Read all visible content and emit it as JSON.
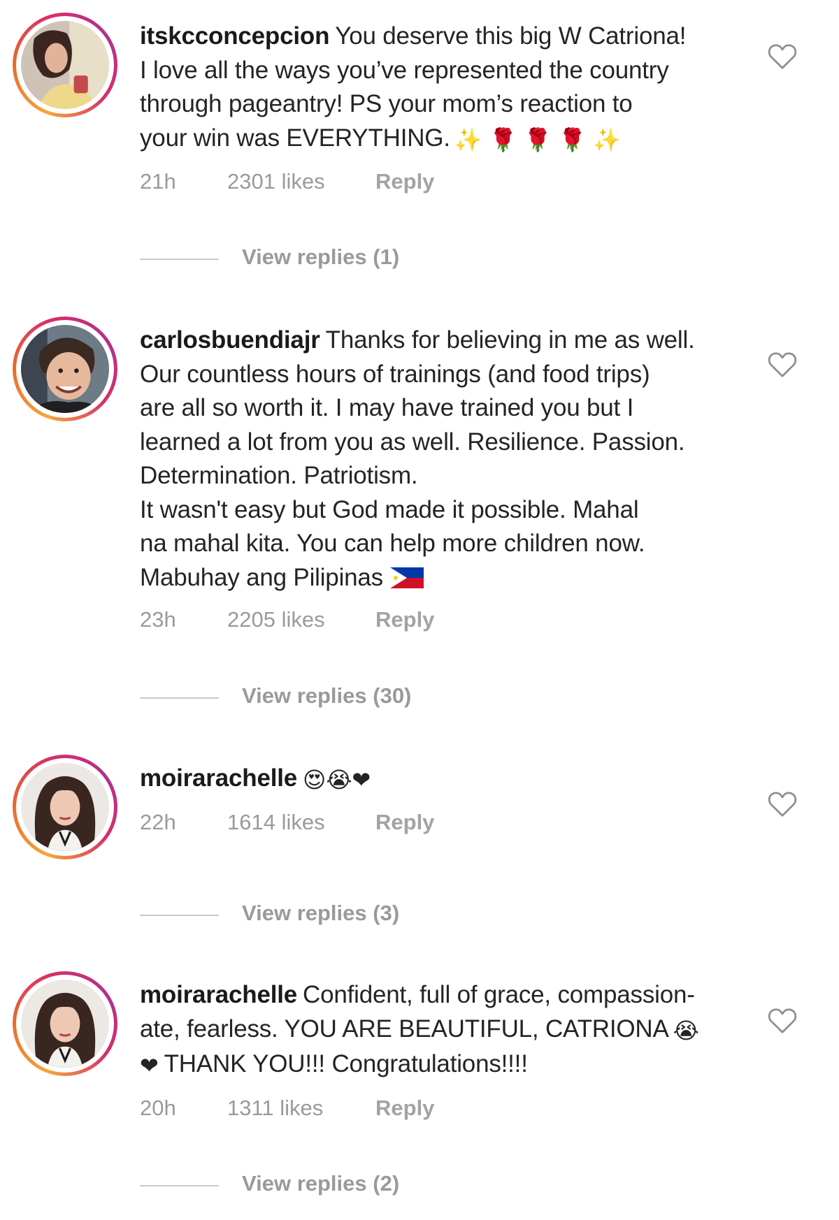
{
  "comments": [
    {
      "username": "itskcconcepcion",
      "text": "You deserve this big W Catriona!\nI love all the ways you’ve represented the country\nthrough pageantry! PS your mom’s reaction to\nyour win was EVERYTHING.",
      "emoji": "✨ 🌹 🌹 🌹 ✨",
      "time": "21h",
      "likes": "2301 likes",
      "reply": "Reply",
      "view_replies": "View replies (1)"
    },
    {
      "username": "carlosbuendiajr",
      "text": "Thanks for believing in me as well.\nOur countless hours of trainings (and food trips)\nare all so worth it. I may have trained you but I\nlearned a lot from you as well. Resilience. Passion.\nDetermination. Patriotism.\nIt wasn't easy but God made it possible. Mahal\nna mahal kita. You can help more children now.\nMabuhay ang Pilipinas",
      "emoji": "",
      "time": "23h",
      "likes": "2205 likes",
      "reply": "Reply",
      "view_replies": "View replies (30)"
    },
    {
      "username": "moirarachelle",
      "text": "",
      "emoji": "😍😭❤",
      "time": "22h",
      "likes": "1614 likes",
      "reply": "Reply",
      "view_replies": "View replies (3)"
    },
    {
      "username": "moirarachelle",
      "text": "Confident, full of grace, compassion-\nate, fearless. YOU ARE BEAUTIFUL, CATRIONA",
      "text_end": "THANK YOU!!! Congratulations!!!!",
      "emoji": "😭",
      "emoji_start": "❤",
      "time": "20h",
      "likes": "1311 likes",
      "reply": "Reply",
      "view_replies": "View replies (2)"
    }
  ],
  "icons": {
    "heart": "heart-outline-icon",
    "flag": "philippines-flag-icon"
  },
  "colors": {
    "story_ring_start": "#f4a73b",
    "story_ring_end": "#b1318e",
    "meta_text": "#9a9a9a"
  }
}
